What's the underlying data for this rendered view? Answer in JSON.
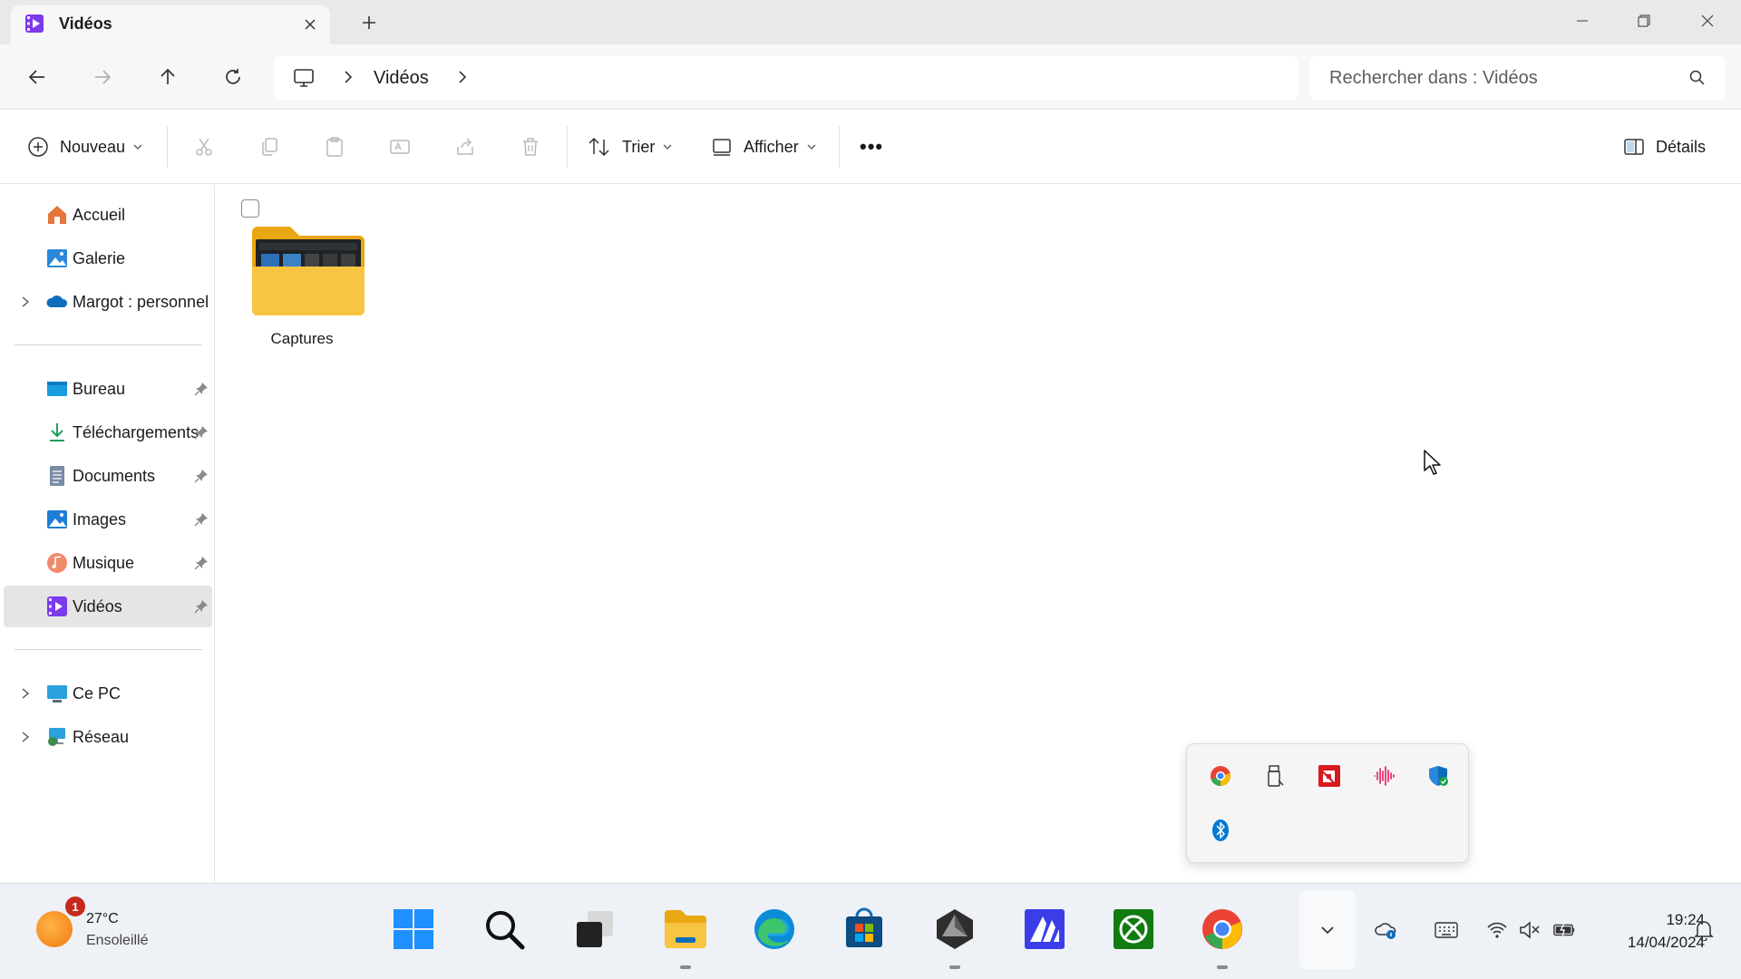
{
  "window": {
    "tab_title": "Vidéos",
    "new_tab_label": "+"
  },
  "address": {
    "crumbs": [
      "Vidéos"
    ],
    "search_placeholder": "Rechercher dans : Vidéos"
  },
  "commands": {
    "new_label": "Nouveau",
    "sort_label": "Trier",
    "view_label": "Afficher",
    "details_label": "Détails",
    "more_label": "•••"
  },
  "sidebar": {
    "quick": [
      {
        "label": "Accueil",
        "icon": "home-icon"
      },
      {
        "label": "Galerie",
        "icon": "gallery-icon"
      },
      {
        "label": "Margot : personnel",
        "icon": "onedrive-icon"
      }
    ],
    "pinned": [
      {
        "label": "Bureau",
        "icon": "desktop-folder-icon"
      },
      {
        "label": "Téléchargements",
        "icon": "download-icon"
      },
      {
        "label": "Documents",
        "icon": "documents-icon"
      },
      {
        "label": "Images",
        "icon": "pictures-icon"
      },
      {
        "label": "Musique",
        "icon": "music-icon"
      },
      {
        "label": "Vidéos",
        "icon": "videos-icon"
      }
    ],
    "devices": [
      {
        "label": "Ce PC",
        "icon": "this-pc-icon"
      },
      {
        "label": "Réseau",
        "icon": "network-icon"
      }
    ],
    "selected": "Vidéos"
  },
  "content": {
    "items": [
      {
        "name": "Captures",
        "type": "folder"
      }
    ]
  },
  "tray_flyout": {
    "icons": [
      "chrome-remote-icon",
      "usb-drive-icon",
      "amd-icon",
      "audio-wave-icon",
      "defender-icon",
      "bluetooth-icon"
    ]
  },
  "taskbar": {
    "weather": {
      "temp": "27°C",
      "desc": "Ensoleillé",
      "badge": "1"
    },
    "apps": [
      "windows-start-icon",
      "search-icon",
      "task-view-icon",
      "file-explorer-icon",
      "edge-icon",
      "store-icon",
      "unity-icon",
      "metaeditor-icon",
      "xbox-icon",
      "chrome-icon"
    ],
    "clock": {
      "time": "19:24",
      "date": "14/04/2024"
    }
  },
  "colors": {
    "accent": "#0067c0",
    "folder": "#f8c542",
    "selection": "#e5e5e5"
  }
}
